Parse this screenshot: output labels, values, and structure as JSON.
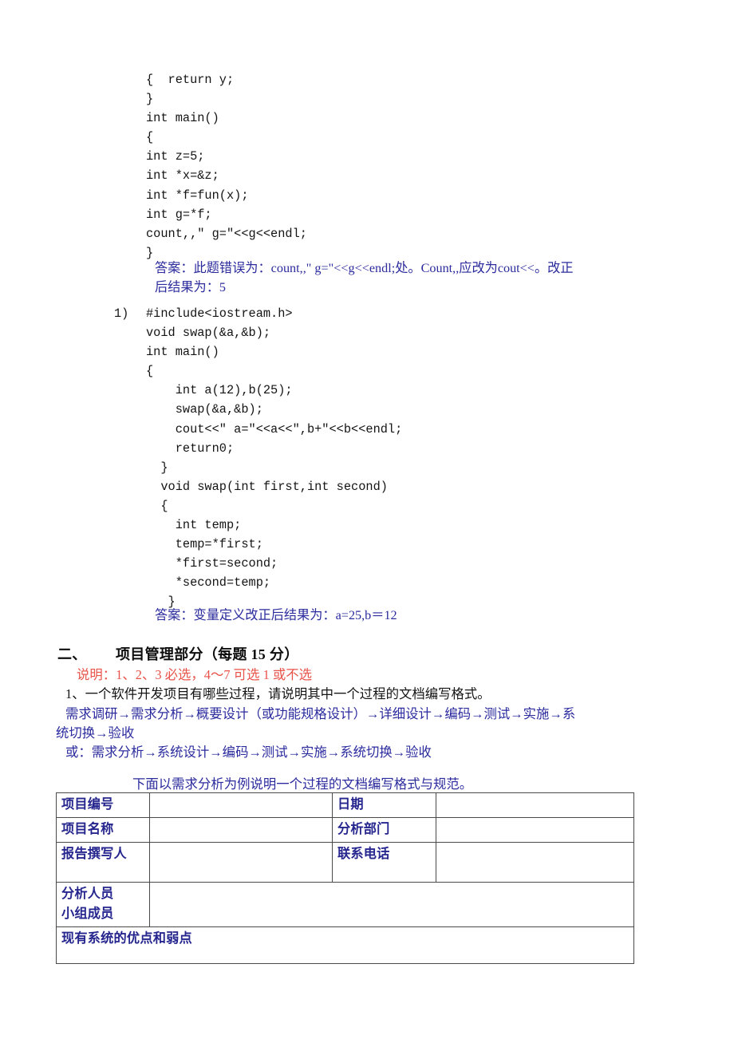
{
  "document": {
    "language": "zh-CN",
    "colors": {
      "blue": "#2b2b9e",
      "navy": "#26268f",
      "red": "#e8534a",
      "black": "#141414",
      "table_border": "#4a4a4a"
    }
  },
  "code_block_1": {
    "lines": [
      "{  return y;",
      "}",
      "int main()",
      "{",
      "int z=5;",
      "int *x=&z;",
      "int *f=fun(x);",
      "int g=*f;",
      "count,,\" g=\"<<g<<endl;",
      "}"
    ]
  },
  "answer_1": {
    "line1": "答案：此题错误为：count,,\" g=\"<<g<<endl;处。Count,,应改为cout<<。改正",
    "line2": "后结果为：5"
  },
  "code_block_2": {
    "marker": "1)",
    "lines": [
      "#include<iostream.h>",
      "void swap(&a,&b);",
      "int main()",
      "{",
      "    int a(12),b(25);",
      "    swap(&a,&b);",
      "    cout<<\" a=\"<<a<<\",b+\"<<b<<endl;",
      "    return0;",
      "  }",
      "  void swap(int first,int second)",
      "  {",
      "    int temp;",
      "    temp=*first;",
      "    *first=second;",
      "    *second=temp;",
      "   }"
    ]
  },
  "answer_2": {
    "text": "答案：变量定义改正后结果为：a=25,b＝12"
  },
  "section_two": {
    "number": "二、",
    "title": "项目管理部分（每题 15 分）",
    "note": "说明：1、2、3 必选，4～7 可选 1 或不选",
    "question_1": "1、一个软件开发项目有哪些过程，请说明其中一个过程的文档编写格式。",
    "flow_line_1": "需求调研→需求分析→概要设计（或功能规格设计）→详细设计→编码→测试→实施→系",
    "flow_line_2": "统切换→验收",
    "flow_line_3": "或：需求分析→系统设计→编码→测试→实施→系统切换→验收",
    "caption": "下面以需求分析为例说明一个过程的文档编写格式与规范。"
  },
  "form_table": {
    "rows": [
      {
        "label_a": "项目编号",
        "value_a": "",
        "label_b": "日期",
        "value_b": ""
      },
      {
        "label_a": "项目名称",
        "value_a": "",
        "label_b": "分析部门",
        "value_b": ""
      },
      {
        "label_a": "报告撰写人",
        "value_a": "",
        "label_b": "联系电话",
        "value_b": ""
      }
    ],
    "row_members": {
      "label": "分析人员\n小组成员",
      "value": ""
    },
    "row_merged": {
      "label": "现有系统的优点和弱点",
      "value": ""
    }
  }
}
